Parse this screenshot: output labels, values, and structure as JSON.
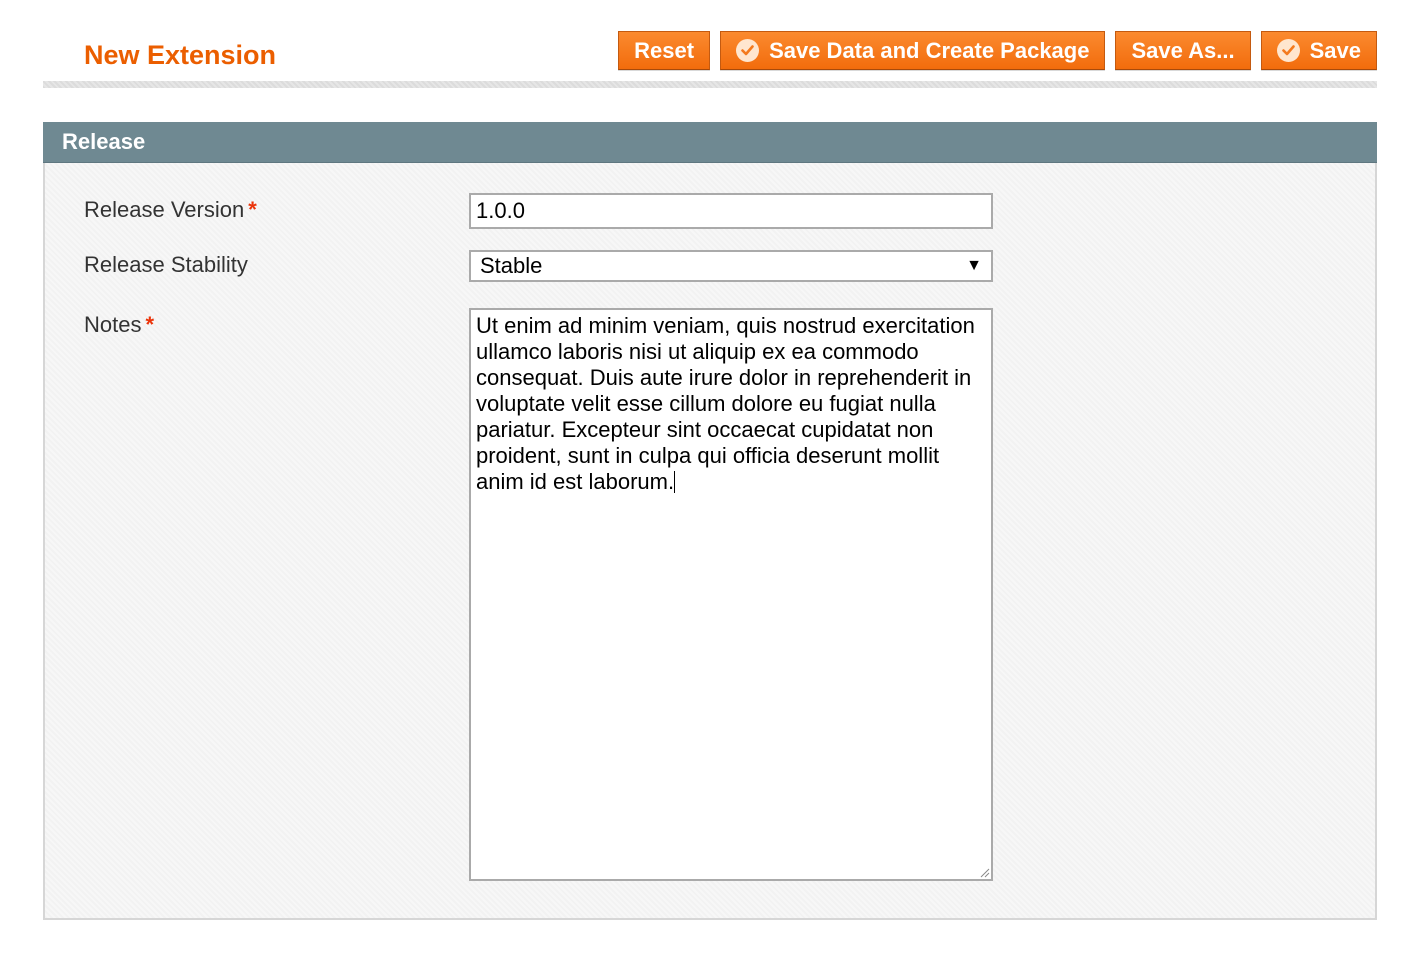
{
  "header": {
    "title": "New Extension"
  },
  "toolbar": {
    "reset_label": "Reset",
    "save_create_label": "Save Data and Create Package",
    "save_as_label": "Save As...",
    "save_label": "Save"
  },
  "fieldset": {
    "title": "Release",
    "release_version": {
      "label": "Release Version",
      "required_mark": "*",
      "value": "1.0.0"
    },
    "release_stability": {
      "label": "Release Stability",
      "selected": "Stable",
      "arrow": "▼"
    },
    "notes": {
      "label": "Notes",
      "required_mark": "*",
      "value": "Ut enim ad minim veniam, quis nostrud exercitation ullamco laboris nisi ut aliquip ex ea commodo consequat. Duis aute irure dolor in reprehenderit in voluptate velit esse cillum dolore eu fugiat nulla pariatur. Excepteur sint occaecat cupidatat non proident, sunt in culpa qui officia deserunt mollit anim id est laborum."
    }
  },
  "colors": {
    "accent": "#eb5e00",
    "button": "#f47a1e",
    "section_header": "#6f8992",
    "required": "#eb340a"
  },
  "icons": {
    "save_create_icon": "check-circle-icon",
    "save_icon": "check-circle-icon",
    "select_arrow": "chevron-down-icon"
  }
}
